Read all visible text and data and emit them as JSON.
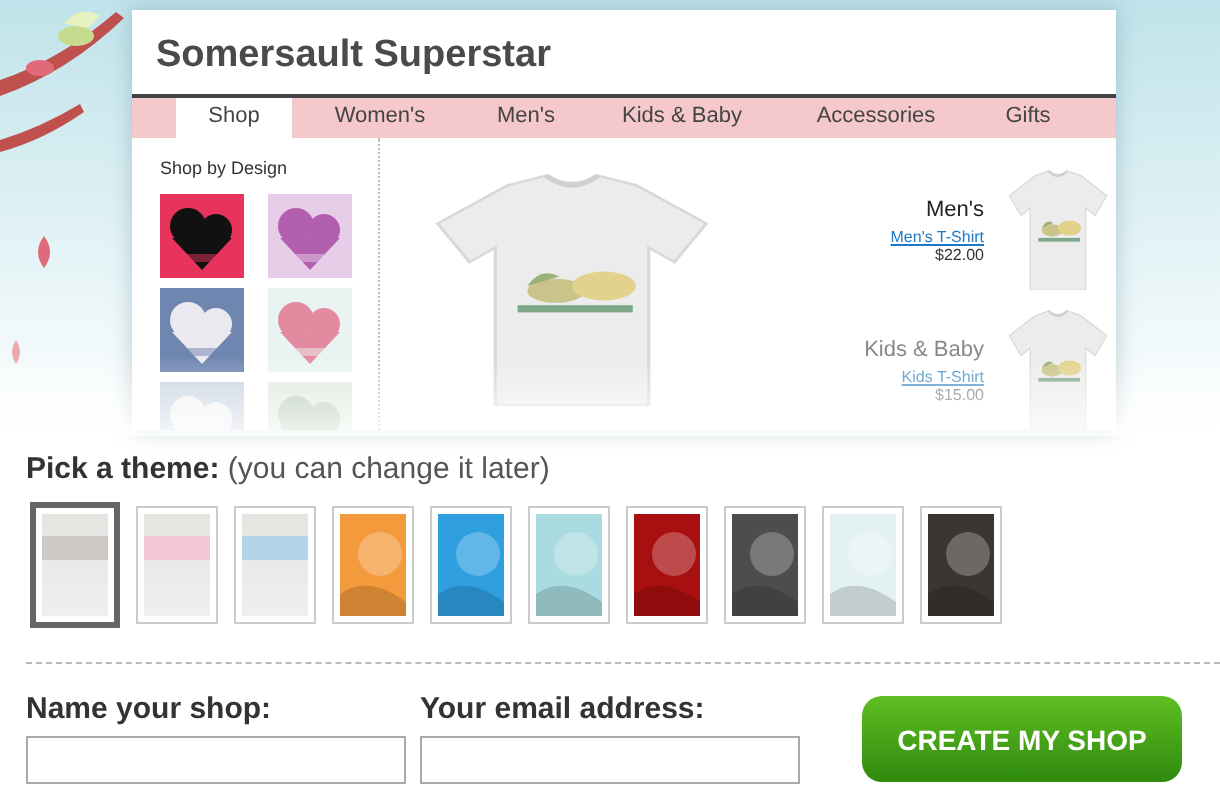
{
  "preview": {
    "shop_title": "Somersault Superstar",
    "tabs": [
      {
        "label": "Shop",
        "selected": true
      },
      {
        "label": "Women's",
        "selected": false
      },
      {
        "label": "Men's",
        "selected": false
      },
      {
        "label": "Kids & Baby",
        "selected": false
      },
      {
        "label": "Accessories",
        "selected": false
      },
      {
        "label": "Gifts",
        "selected": false
      }
    ],
    "sidebar": {
      "heading": "Shop by Design"
    },
    "products": [
      {
        "category": "Men's",
        "link": "Men's T-Shirt",
        "price": "$22.00"
      },
      {
        "category": "Kids & Baby",
        "link": "Kids T-Shirt",
        "price": "$15.00"
      }
    ]
  },
  "theme_picker": {
    "label": "Pick a theme:",
    "hint": "(you can change it later)",
    "themes": [
      {
        "kind": "banded",
        "color": "#cdc9c5",
        "selected": true
      },
      {
        "kind": "banded",
        "color": "#f3c7d6",
        "selected": false
      },
      {
        "kind": "banded",
        "color": "#b3d5ea",
        "selected": false
      },
      {
        "kind": "art",
        "color": "#f29a3c",
        "selected": false
      },
      {
        "kind": "art",
        "color": "#2f9fe0",
        "selected": false
      },
      {
        "kind": "art",
        "color": "#a9dbe0",
        "selected": false
      },
      {
        "kind": "art",
        "color": "#a80f10",
        "selected": false
      },
      {
        "kind": "art",
        "color": "#4d4d4d",
        "selected": false
      },
      {
        "kind": "art",
        "color": "#e4f1f3",
        "selected": false
      },
      {
        "kind": "art",
        "color": "#3b3632",
        "selected": false
      }
    ]
  },
  "form": {
    "fields": [
      {
        "label": "Name your shop:"
      },
      {
        "label": "Your email address:"
      }
    ],
    "button": "CREATE MY SHOP"
  }
}
